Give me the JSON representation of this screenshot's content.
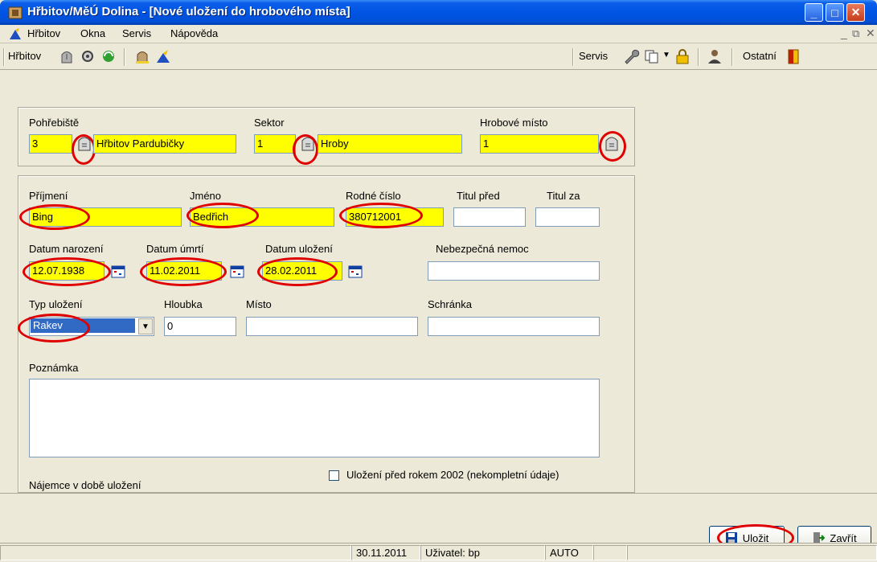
{
  "window": {
    "title": "Hřbitov/MěÚ Dolina - [Nové uložení do hrobového místa]"
  },
  "menu": {
    "items": [
      "Hřbitov",
      "Okna",
      "Servis",
      "Nápověda"
    ]
  },
  "toolbar": {
    "hrbitov_label": "Hřbitov",
    "servis_label": "Servis",
    "ostatni_label": "Ostatní"
  },
  "location": {
    "pohrebiste_label": "Pohřebiště",
    "pohrebiste_code": "3",
    "pohrebiste_name": "Hřbitov Pardubičky",
    "sektor_label": "Sektor",
    "sektor_code": "1",
    "sektor_name": "Hroby",
    "hrobove_misto_label": "Hrobové místo",
    "hrobove_misto_value": "1"
  },
  "person": {
    "prijmeni_label": "Příjmení",
    "prijmeni": "Bing",
    "jmeno_label": "Jméno",
    "jmeno": "Bedřich",
    "rodne_cislo_label": "Rodné číslo",
    "rodne_cislo": "380712001",
    "titul_pred_label": "Titul před",
    "titul_pred": "",
    "titul_za_label": "Titul za",
    "titul_za": "",
    "datum_narozeni_label": "Datum narození",
    "datum_narozeni": "12.07.1938",
    "datum_umrti_label": "Datum úmrtí",
    "datum_umrti": "11.02.2011",
    "datum_ulozeni_label": "Datum uložení",
    "datum_ulozeni": "28.02.2011",
    "nebezpecna_nemoc_label": "Nebezpečná nemoc",
    "nebezpecna_nemoc": "",
    "typ_ulozeni_label": "Typ uložení",
    "typ_ulozeni": "Rakev",
    "hloubka_label": "Hloubka",
    "hloubka": "0",
    "misto_label": "Místo",
    "misto": "",
    "schranka_label": "Schránka",
    "schranka": "",
    "poznamka_label": "Poznámka",
    "poznamka": "",
    "pred_2002_label": "Uložení před rokem 2002 (nekompletní údaje)",
    "najemce_label": "Nájemce v době uložení"
  },
  "buttons": {
    "ulozit": "Uložit",
    "zavrit": "Zavřít"
  },
  "status": {
    "date": "30.11.2011",
    "user": "Uživatel: bp",
    "mode": "AUTO"
  },
  "colors": {
    "highlight": "#ffff00",
    "annotation": "#e00000",
    "titlebar": "#0054e3"
  }
}
